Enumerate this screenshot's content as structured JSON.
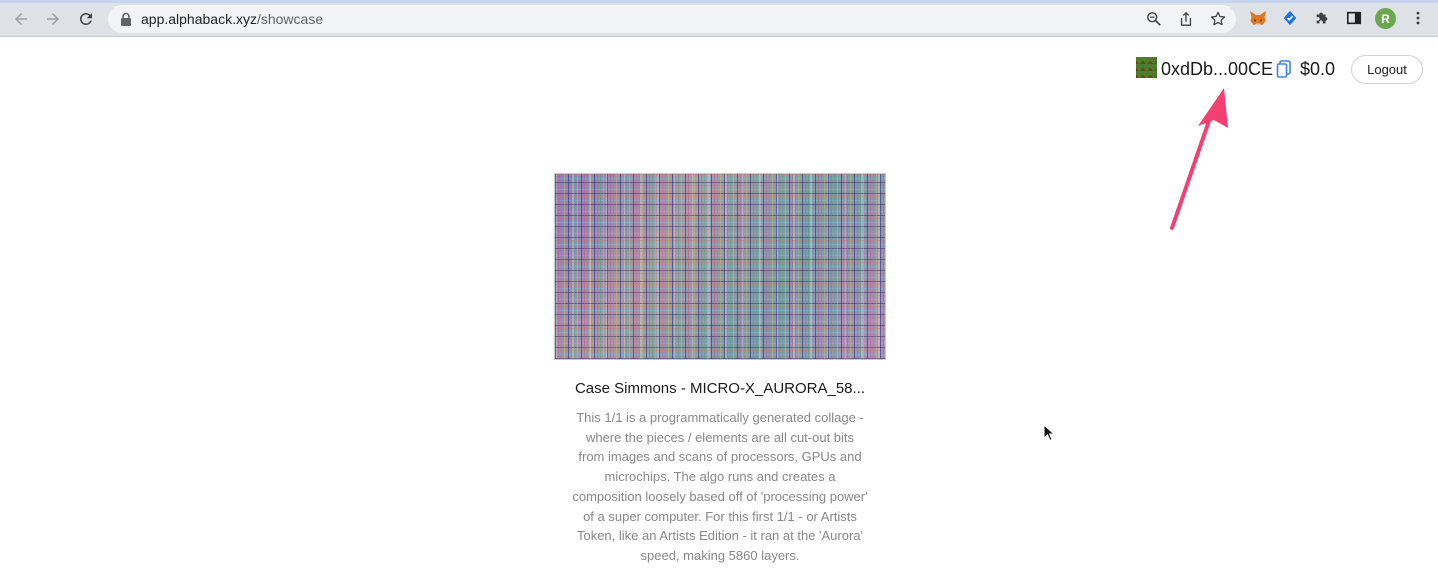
{
  "browser": {
    "url_host": "app.alphaback.xyz",
    "url_path": "/showcase",
    "profile_initial": "R"
  },
  "header": {
    "wallet_address": "0xdDb...00CE",
    "balance": "$0.0",
    "logout_label": "Logout"
  },
  "showcase": {
    "item_title": "Case Simmons - MICRO-X_AURORA_58...",
    "item_description": "This 1/1 is a programmatically generated collage - where the pieces / elements are all cut-out bits from images and scans of processors, GPUs and microchips. The algo runs and creates a composition loosely based off of 'processing power' of a super computer. For this first 1/1 - or Artists Token, like an Artists Edition - it ran at the 'Aurora' speed, making 5860 layers."
  },
  "colors": {
    "annotation_arrow": "#f43f73",
    "copy_icon": "#3b82f6",
    "profile_avatar": "#6aa84f"
  },
  "icons": {
    "back": "back-arrow-icon",
    "forward": "forward-arrow-icon",
    "reload": "reload-icon",
    "lock": "lock-icon",
    "zoom": "zoom-icon",
    "share": "share-icon",
    "bookmark": "star-icon",
    "metamask": "metamask-fox-icon",
    "extension_blue": "blue-extension-icon",
    "extensions": "puzzle-icon",
    "side_panel": "side-panel-icon",
    "menu": "kebab-menu-icon",
    "copy": "copy-icon"
  }
}
